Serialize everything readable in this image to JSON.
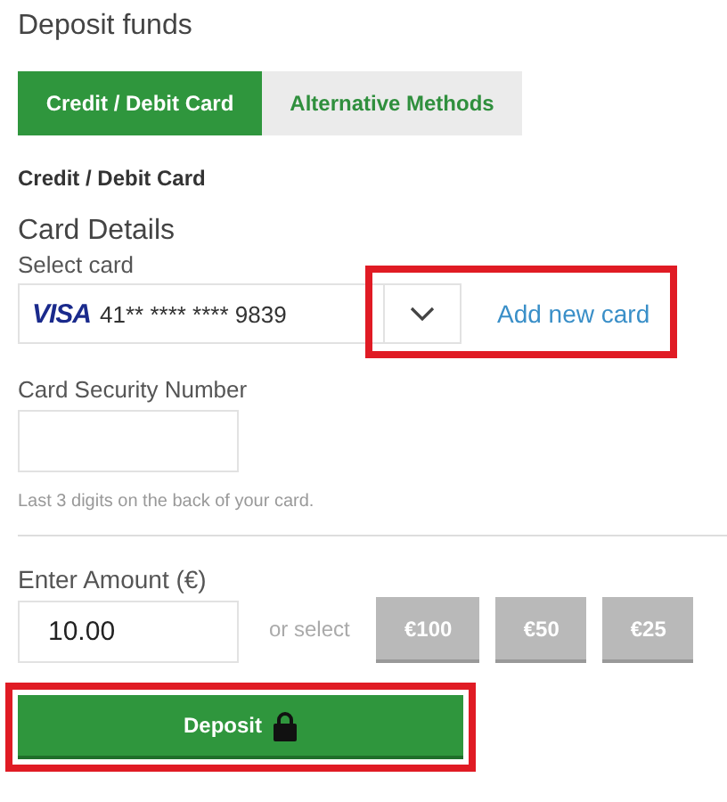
{
  "title": "Deposit funds",
  "tabs": [
    {
      "label": "Credit / Debit Card",
      "selected": true
    },
    {
      "label": "Alternative Methods",
      "selected": false
    }
  ],
  "section_heading": "Credit / Debit Card",
  "card_details": {
    "heading": "Card Details",
    "select_label": "Select card",
    "brand": "VISA",
    "card_number": "41** **** **** 9839",
    "add_card_link": "Add new card",
    "highlighted": true
  },
  "security": {
    "label": "Card Security Number",
    "hint": "Last 3 digits on the back of your card."
  },
  "amount": {
    "label": "Enter Amount (€)",
    "value": "10.00",
    "or_select": "or select",
    "presets": [
      "€100",
      "€50",
      "€25"
    ]
  },
  "deposit_button": {
    "label": "Deposit",
    "highlighted": true
  }
}
